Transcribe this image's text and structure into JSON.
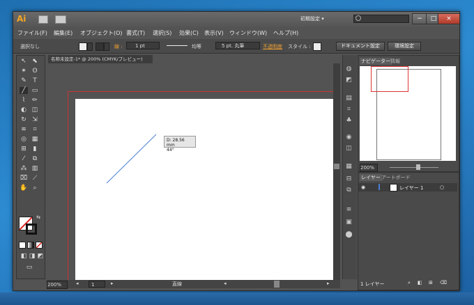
{
  "titlebar": {
    "logo": "Ai",
    "workspace": "初期設定",
    "search_placeholder": "",
    "minimize": "−",
    "maximize": "□",
    "close": "×"
  },
  "menu": [
    "ファイル(F)",
    "編集(E)",
    "オブジェクト(O)",
    "書式(T)",
    "選択(S)",
    "効果(C)",
    "表示(V)",
    "ウィンドウ(W)",
    "ヘルプ(H)"
  ],
  "control": {
    "selection": "選択なし",
    "stroke_label": "線 :",
    "stroke_value": "1 pt",
    "line_style": "均等",
    "brush": "5 pt. 丸筆",
    "opacity_label": "不透明度",
    "style_label": "スタイル :",
    "doc_settings": "ドキュメント設定",
    "preferences": "環境設定"
  },
  "document": {
    "tab_title": "名称未設定-1* @ 200% (CMYK/プレビュー)",
    "tab_close": "×"
  },
  "measure": {
    "line1": "D: 28.56 mm",
    "line2": "44°"
  },
  "status": {
    "zoom": "200%",
    "page": "1",
    "tool": "直線"
  },
  "navigator": {
    "tab1": "ナビゲーター",
    "tab2": "情報",
    "zoom": "200%"
  },
  "layers": {
    "tab1": "レイヤー",
    "tab2": "アートボード",
    "layer_name": "レイヤー 1",
    "count": "1 レイヤー"
  },
  "colors": {
    "accent_logo": "#f5a623",
    "artboard_border": "#cc3333",
    "line": "#4a7fd4"
  }
}
